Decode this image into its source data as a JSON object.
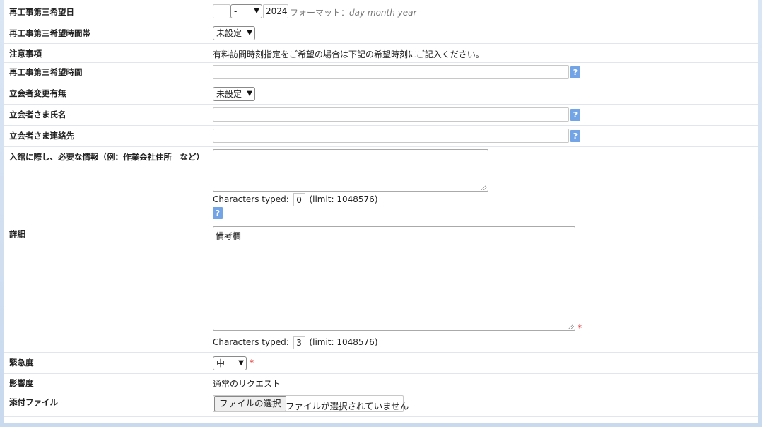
{
  "rows": {
    "date3": {
      "label": "再工事第三希望日",
      "month_value": "-",
      "year_value": "2024",
      "format_label": "フォーマット：",
      "format_value": "day month year"
    },
    "timeband3": {
      "label": "再工事第三希望時間帯",
      "selected": "未設定"
    },
    "caution": {
      "label": "注意事項",
      "text": "有料訪問時刻指定をご希望の場合は下記の希望時刻にご記入ください。"
    },
    "time3": {
      "label": "再工事第三希望時間",
      "help": "?"
    },
    "attendee_change": {
      "label": "立会者変更有無",
      "selected": "未設定"
    },
    "attendee_name": {
      "label": "立会者さま氏名",
      "help": "?"
    },
    "attendee_contact": {
      "label": "立会者さま連絡先",
      "help": "?"
    },
    "entry_info": {
      "label": "入館に際し、必要な情報（例：作業会社住所　など）",
      "counter_prefix": "Characters typed:",
      "count": "0",
      "limit": "(limit: 1048576)",
      "help": "?"
    },
    "details": {
      "label": "詳細",
      "value": "備考欄",
      "counter_prefix": "Characters typed:",
      "count": "3",
      "limit": "(limit: 1048576)",
      "required_mark": "*"
    },
    "urgency": {
      "label": "緊急度",
      "selected": "中",
      "required_mark": "*"
    },
    "impact": {
      "label": "影響度",
      "value": "通常のリクエスト"
    },
    "attachment": {
      "label": "添付ファイル",
      "button": "ファイルの選択",
      "status": "ファイルが選択されていません"
    }
  }
}
